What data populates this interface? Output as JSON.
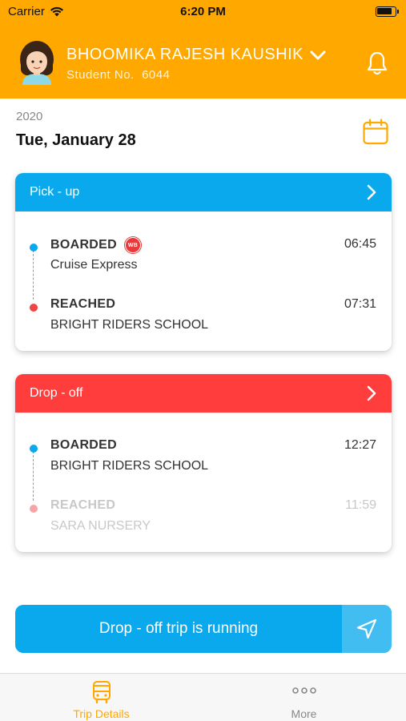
{
  "status_bar": {
    "carrier": "Carrier",
    "time": "6:20 PM"
  },
  "header": {
    "student_name": "BHOOMIKA RAJESH KAUSHIK",
    "student_no_label": "Student No.",
    "student_no": "6044"
  },
  "date": {
    "year": "2020",
    "day": "Tue, January 28"
  },
  "pickup": {
    "title": "Pick - up",
    "stops": [
      {
        "status": "BOARDED",
        "badge": "WB",
        "place": "Cruise Express",
        "time": "06:45"
      },
      {
        "status": "REACHED",
        "place": "BRIGHT RIDERS SCHOOL",
        "time": "07:31"
      }
    ]
  },
  "dropoff": {
    "title": "Drop - off",
    "stops": [
      {
        "status": "BOARDED",
        "place": "BRIGHT RIDERS SCHOOL",
        "time": "12:27"
      },
      {
        "status": "REACHED",
        "place": "SARA NURSERY",
        "time": "11:59"
      }
    ]
  },
  "trip_banner": {
    "text": "Drop - off trip is running"
  },
  "tabbar": {
    "tabs": [
      {
        "label": "Trip Details",
        "icon": "bus-icon",
        "active": true
      },
      {
        "label": "More",
        "icon": "more-dots-icon",
        "active": false
      }
    ]
  },
  "colors": {
    "brand": "#FFA800",
    "pickup": "#0AA8EC",
    "dropoff": "#FF3D3D",
    "boarded_dot": "#0AA8EC",
    "reached_dot": "#F04545",
    "badge": "#E83A3A"
  }
}
